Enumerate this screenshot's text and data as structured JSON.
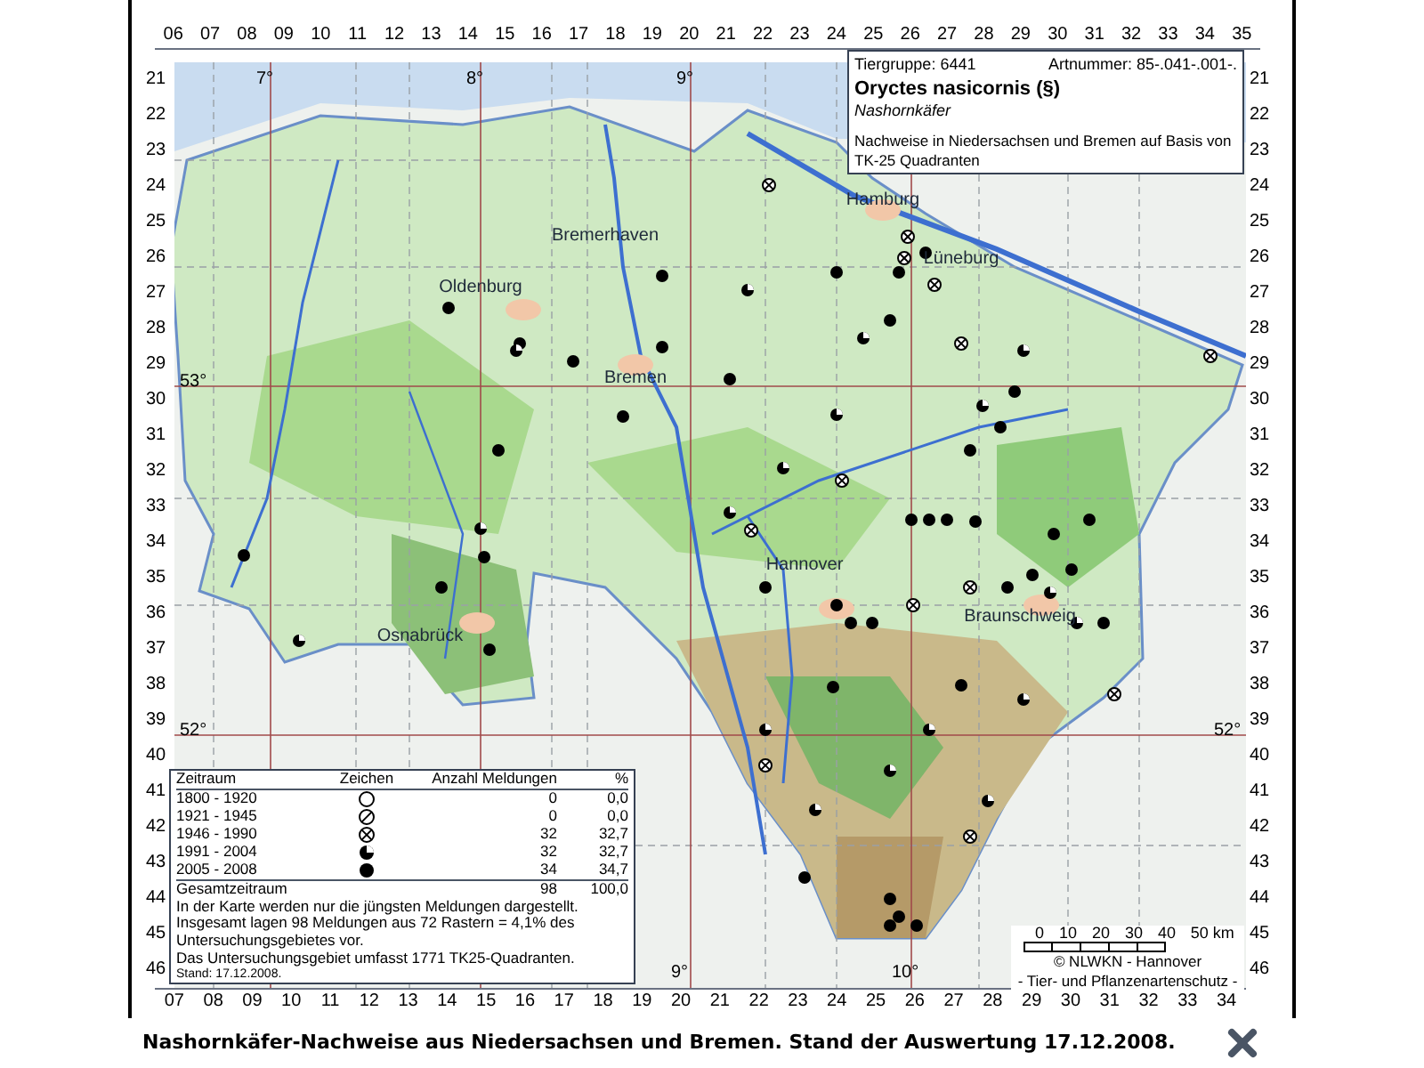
{
  "header_box": {
    "group": "Tiergruppe: 6441",
    "number": "Artnummer: 85-.041-.001-.",
    "species": "Oryctes nasicornis (§)",
    "common_name": "Nashornkäfer",
    "description": "Nachweise in Niedersachsen und Bremen auf Basis von TK-25 Quadranten"
  },
  "grid": {
    "top_columns": [
      "06",
      "07",
      "08",
      "09",
      "10",
      "11",
      "12",
      "13",
      "14",
      "15",
      "16",
      "17",
      "18",
      "19",
      "20",
      "21",
      "22",
      "23",
      "24",
      "25",
      "26",
      "27",
      "28",
      "29",
      "30",
      "31",
      "32",
      "33",
      "34",
      "35"
    ],
    "bottom_columns": [
      "07",
      "08",
      "09",
      "10",
      "11",
      "12",
      "13",
      "14",
      "15",
      "16",
      "17",
      "18",
      "19",
      "20",
      "21",
      "22",
      "23",
      "24",
      "25",
      "26",
      "27",
      "28",
      "29",
      "30",
      "31",
      "32",
      "33",
      "34"
    ],
    "left_rows": [
      "21",
      "22",
      "23",
      "24",
      "25",
      "26",
      "27",
      "28",
      "29",
      "30",
      "31",
      "32",
      "33",
      "34",
      "35",
      "36",
      "37",
      "38",
      "39",
      "40",
      "41",
      "42",
      "43",
      "44",
      "45",
      "46"
    ],
    "right_rows": [
      "21",
      "22",
      "23",
      "24",
      "25",
      "26",
      "27",
      "28",
      "29",
      "30",
      "31",
      "32",
      "33",
      "34",
      "35",
      "36",
      "37",
      "38",
      "39",
      "40",
      "41",
      "42",
      "43",
      "44",
      "45",
      "46"
    ]
  },
  "map_labels": [
    {
      "text": "7°"
    },
    {
      "text": "8°"
    },
    {
      "text": "9°"
    },
    {
      "text": "53°"
    },
    {
      "text": "52°"
    },
    {
      "text": "52°"
    },
    {
      "text": "9°"
    },
    {
      "text": "10°"
    },
    {
      "text": "Bremerhaven"
    },
    {
      "text": "Oldenburg"
    },
    {
      "text": "Bremen"
    },
    {
      "text": "Hamburg"
    },
    {
      "text": "Lüneburg"
    },
    {
      "text": "Hannover"
    },
    {
      "text": "Braunschweig"
    },
    {
      "text": "Osnabrück"
    }
  ],
  "legend": {
    "columns": [
      "Zeitraum",
      "Zeichen",
      "Anzahl Meldungen",
      "%"
    ],
    "rows": [
      {
        "period": "1800 - 1920",
        "kind": "open",
        "count": "0",
        "percent": "0,0"
      },
      {
        "period": "1921 - 1945",
        "kind": "slashed",
        "count": "0",
        "percent": "0,0"
      },
      {
        "period": "1946 - 1990",
        "kind": "crossed",
        "count": "32",
        "percent": "32,7"
      },
      {
        "period": "1991 - 2004",
        "kind": "half",
        "count": "32",
        "percent": "32,7"
      },
      {
        "period": "2005 - 2008",
        "kind": "full",
        "count": "34",
        "percent": "34,7"
      }
    ],
    "total": {
      "label": "Gesamtzeitraum",
      "count": "98",
      "percent": "100,0"
    },
    "notes": [
      "In der Karte werden nur die jüngsten Meldungen dargestellt.",
      "Insgesamt lagen 98 Meldungen aus 72 Rastern = 4,1% des Untersuchungsgebietes vor.",
      "Das Untersuchungsgebiet umfasst 1771 TK25-Quadranten."
    ],
    "date": "Stand: 17.12.2008."
  },
  "scale": {
    "ticks": [
      "0",
      "10",
      "20",
      "30",
      "40",
      "50 km"
    ],
    "credit": [
      "© NLWKN - Hannover",
      "- Tier- und Pflanzenartenschutz -"
    ]
  },
  "caption": "Nashornkäfer-Nachweise aus Niedersachsen und Bremen. Stand der Auswertung 17.12.2008."
}
